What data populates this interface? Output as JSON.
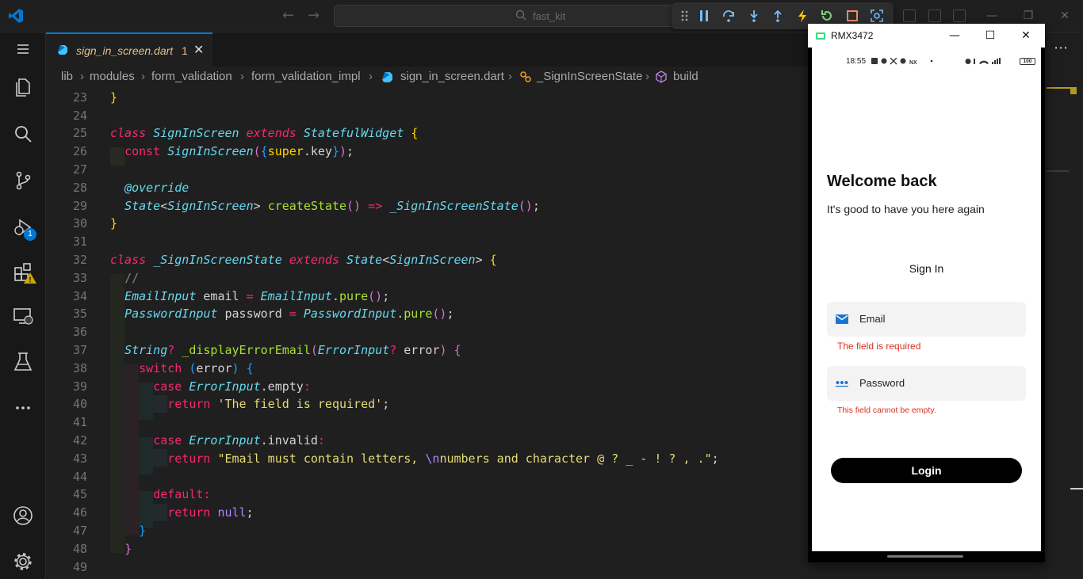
{
  "titlebar": {
    "search_text": "fast_kit",
    "back_icon": "arrow-left-icon",
    "forward_icon": "arrow-right-icon"
  },
  "activity_bar": {
    "items": [
      {
        "name": "menu-icon"
      },
      {
        "name": "explorer-icon"
      },
      {
        "name": "search-icon"
      },
      {
        "name": "source-control-icon"
      },
      {
        "name": "run-debug-icon",
        "badge": "1"
      },
      {
        "name": "extensions-icon",
        "warning": true
      },
      {
        "name": "remote-explorer-icon"
      },
      {
        "name": "testing-icon"
      },
      {
        "name": "more-icon"
      }
    ],
    "bottom": [
      {
        "name": "account-icon"
      },
      {
        "name": "settings-gear-icon"
      }
    ]
  },
  "tab": {
    "label": "sign_in_screen.dart",
    "problems": "1"
  },
  "breadcrumb": [
    "lib",
    "modules",
    "form_validation",
    "form_validation_impl",
    "sign_in_screen.dart",
    "_SignInScreenState",
    "build"
  ],
  "editor": {
    "line_numbers": [
      "23",
      "24",
      "25",
      "26",
      "27",
      "28",
      "29",
      "30",
      "31",
      "32",
      "33",
      "34",
      "35",
      "36",
      "37",
      "38",
      "39",
      "40",
      "41",
      "42",
      "43",
      "44",
      "45",
      "46",
      "47",
      "48",
      "49"
    ]
  },
  "emulator": {
    "window_title": "RMX3472",
    "status_time": "18:55",
    "status_battery": "100",
    "heading": "Welcome back",
    "subheading": "It's good to have you here again",
    "section_title": "Sign In",
    "email_label": "Email",
    "email_error": "The field is required",
    "password_label": "Password",
    "password_error": "This field cannot be empty.",
    "login_label": "Login"
  },
  "colors": {
    "accent": "#0078d4",
    "error": "#d93025"
  }
}
